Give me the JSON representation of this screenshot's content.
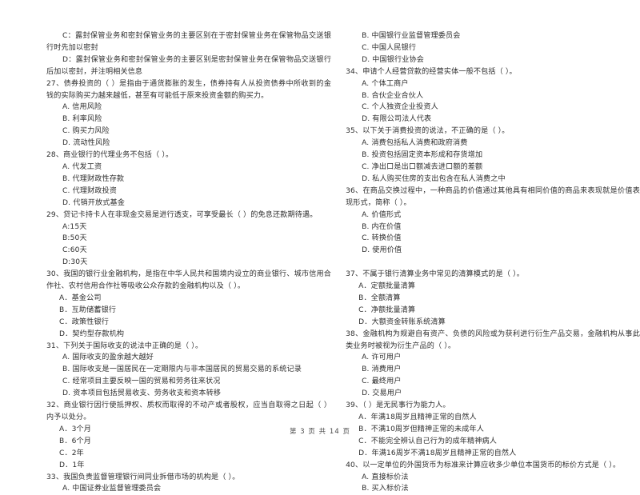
{
  "document": {
    "footer": "第 3 页 共 14 页"
  },
  "left_column": {
    "carryover": [
      "C：露封保管业务和密封保管业务的主要区别在于密封保管业务在保管物品交送银行时先加以密封",
      "D：露封保管业务和密封保管业务的主要区别是密封保管业务在保管物品交送银行后加以密封，并注明相关信息"
    ],
    "questions": [
      {
        "number": "27、",
        "stem": "债券投资的（      ）是指由于通货膨胀的发生，债券持有人从投资债券中所收到的金钱的实际购买力越来越低，甚至有可能低于原来投资金额的购买力。",
        "options": [
          "A. 信用风险",
          "B. 利率风险",
          "C. 购买力风险",
          "D. 流动性风险"
        ]
      },
      {
        "number": "28、",
        "stem": "商业银行的代理业务不包括（      ）。",
        "options": [
          "A. 代发工资",
          "B. 代理财政性存款",
          "C. 代理财政投资",
          "D. 代销开放式基金"
        ]
      },
      {
        "number": "29、",
        "stem": "贷记卡持卡人在非现金交易是进行透支，可享受最长（      ）的免息还款期待遇。",
        "options": [
          "A:15天",
          "B:50天",
          "C:60天",
          "D:30天"
        ]
      },
      {
        "number": "30、",
        "stem": "我国的银行业金融机构，是指在中华人民共和国境内设立的商业银行、城市信用合作社、农村信用合作社等吸收公众存款的金融机构以及（      ）。",
        "options": [
          "A．基金公司",
          "B．互助储蓄银行",
          "C．政策性银行",
          "D．契约型存款机构"
        ]
      },
      {
        "number": "31、",
        "stem": "下列关于国际收支的说法中正确的是（      ）。",
        "options": [
          "A. 国际收支的盈余越大越好",
          "B. 国际收支是一国居民在一定期限内与非本国居民的贸易交易的系统记录",
          "C. 经常项目主要反映一国的贸易和劳务往来状况",
          "D. 资本项目包括贸易收支、劳务收支和资本转移"
        ]
      },
      {
        "number": "32、",
        "stem": "商业银行因行使抵押权、质权而取得的不动产或者股权，应当自取得之日起（      ）内予以处分。",
        "options": [
          "A．3个月",
          "B．6个月",
          "C．2年",
          "D．1年"
        ]
      },
      {
        "number": "33、",
        "stem": "我国负责监督管理银行间同业拆借市场的机构是（      ）。",
        "options": [
          "A. 中国证券业监督管理委员会"
        ]
      }
    ]
  },
  "right_column": {
    "carryover_options": [
      "B. 中国银行业监督管理委员会",
      "C. 中国人民银行",
      "D. 中国银行业协会"
    ],
    "questions": [
      {
        "number": "34、",
        "stem": "申请个人经营贷款的经营实体一般不包括（      ）。",
        "options": [
          "A. 个体工商户",
          "B. 合伙企业合伙人",
          "C. 个人独资企业投资人",
          "D. 有限公司法人代表"
        ]
      },
      {
        "number": "35、",
        "stem": "以下关于消费投资的说法，不正确的是（      ）。",
        "options": [
          "A. 消费包括私人消费和政府消费",
          "B. 投资包括固定资本形成和存货增加",
          "C. 净出口是出口额减去进口额的差额",
          "D. 私人购买住房的支出包含在私人消费之中"
        ]
      },
      {
        "number": "36、",
        "stem": "在商品交换过程中，一种商品的价值通过其他具有相同价值的商品来表现就是价值表现形式，简称（      ）。",
        "options": [
          "A. 价值形式",
          "B. 内在价值",
          "C. 转换价值",
          "D. 使用价值"
        ]
      },
      {
        "number": "37、",
        "stem": "不属于银行清算业务中常见的清算模式的是（      ）。",
        "options": [
          "A．定额批量清算",
          "B．全额清算",
          "C．净额批量清算",
          "D．大额资金转账系统清算"
        ]
      },
      {
        "number": "38、",
        "stem": "金融机构为规避自有资产、负债的风险或为获利进行衍生产品交易，金融机构从事此类业务时被视为衍生产品的（      ）。",
        "options": [
          "A. 许可用户",
          "B. 消费用户",
          "C. 最终用户",
          "D. 交易用户"
        ]
      },
      {
        "number": "39、",
        "stem": "（      ）是无民事行为能力人。",
        "options": [
          "A．年满18周岁且精神正常的自然人",
          "B．不满10周岁但精神正常的未成年人",
          "C．不能完全辨认自己行为的成年精神病人",
          "D．年满16周岁不满18周岁且精神正常的自然人"
        ]
      },
      {
        "number": "40、",
        "stem": "以一定单位的外国货币为标准来计算应收多少单位本国货币的标价方式是（      ）。",
        "options": [
          "A. 直接标价法",
          "B. 买入标价法"
        ]
      }
    ]
  }
}
